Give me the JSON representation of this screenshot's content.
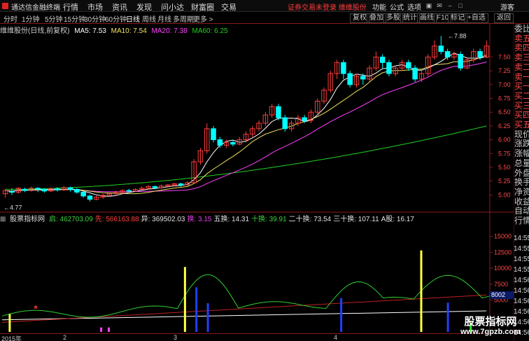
{
  "app": {
    "title": "通达信金融终端"
  },
  "menu": [
    "行情",
    "市场",
    "资讯",
    "发现",
    "问小达",
    "财富圈",
    "交易"
  ],
  "marquee": "证券交易未登录 维维股份",
  "right_menu": [
    "功能",
    "公式",
    "选项"
  ],
  "visitor": "游客",
  "toolbar": {
    "periods": [
      "分时",
      "1分钟",
      "5分钟",
      "15分钟",
      "30分钟",
      "60分钟",
      "日线",
      "周线",
      "月线",
      "多周期",
      "更多 >"
    ],
    "active_period": "日线",
    "buttons": [
      "复权",
      "叠加",
      "多股",
      "统计",
      "画线",
      "F10",
      "标记",
      "+自选",
      "返回"
    ]
  },
  "main_chart": {
    "title": "维维股份(日线,前复权)",
    "ma5": "MA5: 7.53",
    "ma10": "MA10: 7.54",
    "ma20": "MA20: 7.38",
    "ma60": "MA60: 6.25",
    "high_label": "7.88",
    "low_label": "4.77",
    "y_ticks": [
      "7.50",
      "7.25",
      "7.00",
      "6.75",
      "6.50",
      "6.25",
      "6.00",
      "5.75",
      "5.50",
      "5.25",
      "5.00"
    ]
  },
  "indicator": {
    "name": "股票指标网",
    "values": [
      {
        "label": "启: 462703.09",
        "color": "#40d040"
      },
      {
        "label": "先: 566163.88",
        "color": "#ff4040"
      },
      {
        "label": "异: 369502.03",
        "color": "#e0e0e0"
      },
      {
        "label": "换: 3.15",
        "color": "#e040e0"
      },
      {
        "label": "五换: 14.31",
        "color": "#e0e0e0"
      },
      {
        "label": "十换: 39.91",
        "color": "#40d040"
      },
      {
        "label": "二十换: 73.54",
        "color": "#e0e0e0"
      },
      {
        "label": "三十换: 107.11",
        "color": "#e0e0e0"
      },
      {
        "label": "A股: 16.17",
        "color": "#e0e0e0"
      }
    ],
    "y_ticks": [
      "15000",
      "12500",
      "10000",
      "7500",
      "5000"
    ],
    "box_value": "8002"
  },
  "x_axis": [
    "2015年",
    "2",
    "3",
    "4"
  ],
  "sidebar": [
    "委比",
    "卖五",
    "卖四",
    "卖三",
    "卖二",
    "卖一",
    "买一",
    "买二",
    "买三",
    "买四",
    "买五",
    "现价",
    "涨跌",
    "涨幅",
    "总量",
    "外盘",
    "换手",
    "净资",
    "收益",
    "自动",
    "行情"
  ],
  "times": [
    "14:55",
    "14:55",
    "14:55",
    "14:55",
    "14:56",
    "14:56",
    "14:56",
    "14:56",
    "14:56",
    "14:56"
  ],
  "watermark": {
    "title": "股票指标网",
    "url": "www.7gpzb.com"
  },
  "colors": {
    "up": "#ff3b3b",
    "down": "#00ffff",
    "ma5": "#ffffff",
    "ma10": "#f0e060",
    "ma20": "#ff40ff",
    "ma60": "#20d020"
  },
  "chart_data": [
    {
      "type": "candlestick",
      "title": "维维股份(日线,前复权)",
      "ylim": [
        4.75,
        7.95
      ],
      "series": [
        {
          "name": "MA5",
          "value": 7.53
        },
        {
          "name": "MA10",
          "value": 7.54
        },
        {
          "name": "MA20",
          "value": 7.38
        },
        {
          "name": "MA60",
          "value": 6.25
        }
      ],
      "candles": [
        [
          5.02,
          5.08,
          4.95,
          5.1
        ],
        [
          5.06,
          5.05,
          5.0,
          5.12
        ],
        [
          5.05,
          5.12,
          5.02,
          5.14
        ],
        [
          5.1,
          5.08,
          5.05,
          5.13
        ],
        [
          5.08,
          5.12,
          5.06,
          5.15
        ],
        [
          5.12,
          5.1,
          5.05,
          5.14
        ],
        [
          5.1,
          5.07,
          5.04,
          5.12
        ],
        [
          5.07,
          5.11,
          5.05,
          5.13
        ],
        [
          5.11,
          5.09,
          5.06,
          5.14
        ],
        [
          5.09,
          5.13,
          5.07,
          5.16
        ],
        [
          5.13,
          5.1,
          5.06,
          5.15
        ],
        [
          5.1,
          5.05,
          5.02,
          5.12
        ],
        [
          5.05,
          4.98,
          4.95,
          5.08
        ],
        [
          4.98,
          4.92,
          4.88,
          5.0
        ],
        [
          4.92,
          4.96,
          4.9,
          4.99
        ],
        [
          4.96,
          4.99,
          4.93,
          5.02
        ],
        [
          4.99,
          5.02,
          4.96,
          5.05
        ],
        [
          5.02,
          5.05,
          5.0,
          5.08
        ],
        [
          5.05,
          5.08,
          5.02,
          5.1
        ],
        [
          5.08,
          5.07,
          5.04,
          5.11
        ],
        [
          5.07,
          5.1,
          5.05,
          5.12
        ],
        [
          5.1,
          5.12,
          5.08,
          5.15
        ],
        [
          5.12,
          5.15,
          5.1,
          5.18
        ],
        [
          5.15,
          5.13,
          5.1,
          5.17
        ],
        [
          5.13,
          5.16,
          5.11,
          5.19
        ],
        [
          5.16,
          5.18,
          5.14,
          5.2
        ],
        [
          5.18,
          5.2,
          5.16,
          5.22
        ],
        [
          5.2,
          5.18,
          5.15,
          5.22
        ],
        [
          5.18,
          5.22,
          5.17,
          5.25
        ],
        [
          5.22,
          5.6,
          5.2,
          5.65
        ],
        [
          5.6,
          5.8,
          5.55,
          5.85
        ],
        [
          5.8,
          6.2,
          5.75,
          6.3
        ],
        [
          6.2,
          6.0,
          5.95,
          6.25
        ],
        [
          6.0,
          5.9,
          5.85,
          6.05
        ],
        [
          5.9,
          5.95,
          5.85,
          6.0
        ],
        [
          5.95,
          5.92,
          5.88,
          6.0
        ],
        [
          5.92,
          6.0,
          5.9,
          6.05
        ],
        [
          6.0,
          6.1,
          5.95,
          6.15
        ],
        [
          6.1,
          6.2,
          6.05,
          6.25
        ],
        [
          6.2,
          6.3,
          6.15,
          6.35
        ],
        [
          6.3,
          6.45,
          6.25,
          6.5
        ],
        [
          6.45,
          6.6,
          6.4,
          6.65
        ],
        [
          6.6,
          6.4,
          6.35,
          6.65
        ],
        [
          6.4,
          6.2,
          6.15,
          6.45
        ],
        [
          6.2,
          6.3,
          6.15,
          6.35
        ],
        [
          6.3,
          6.4,
          6.25,
          6.45
        ],
        [
          6.4,
          6.35,
          6.3,
          6.45
        ],
        [
          6.35,
          6.5,
          6.3,
          6.55
        ],
        [
          6.5,
          6.7,
          6.45,
          6.75
        ],
        [
          6.7,
          6.9,
          6.65,
          6.95
        ],
        [
          6.9,
          7.2,
          6.85,
          7.25
        ],
        [
          7.2,
          7.4,
          7.1,
          7.45
        ],
        [
          7.4,
          7.2,
          7.1,
          7.45
        ],
        [
          7.2,
          7.0,
          6.95,
          7.25
        ],
        [
          7.0,
          7.15,
          6.95,
          7.2
        ],
        [
          7.15,
          7.1,
          7.0,
          7.2
        ],
        [
          7.1,
          7.3,
          7.05,
          7.35
        ],
        [
          7.3,
          7.5,
          7.25,
          7.6
        ],
        [
          7.5,
          7.4,
          7.3,
          7.55
        ],
        [
          7.4,
          7.2,
          7.15,
          7.45
        ],
        [
          7.2,
          7.3,
          7.15,
          7.35
        ],
        [
          7.3,
          7.4,
          7.25,
          7.45
        ],
        [
          7.4,
          7.3,
          7.25,
          7.45
        ],
        [
          7.3,
          7.1,
          7.05,
          7.35
        ],
        [
          7.1,
          7.2,
          7.05,
          7.25
        ],
        [
          7.2,
          7.5,
          7.15,
          7.55
        ],
        [
          7.5,
          7.7,
          7.45,
          7.8
        ],
        [
          7.7,
          7.6,
          7.55,
          7.88
        ],
        [
          7.6,
          7.5,
          7.45,
          7.65
        ],
        [
          7.5,
          7.55,
          7.45,
          7.6
        ],
        [
          7.55,
          7.3,
          7.25,
          7.6
        ],
        [
          7.3,
          7.45,
          7.28,
          7.5
        ],
        [
          7.45,
          7.6,
          7.4,
          7.65
        ],
        [
          7.6,
          7.5,
          7.45,
          7.65
        ],
        [
          7.5,
          7.7,
          7.48,
          7.8
        ]
      ]
    },
    {
      "type": "bar",
      "title": "股票指标网",
      "ylim": [
        0,
        16500
      ],
      "bars": [
        {
          "index": 2,
          "value": 2800,
          "color": "yellow"
        },
        {
          "index": 26,
          "value": 700,
          "color": "magenta"
        },
        {
          "index": 28,
          "value": 700,
          "color": "magenta"
        },
        {
          "index": 48,
          "value": 10200,
          "color": "yellow"
        },
        {
          "index": 51,
          "value": 7000,
          "color": "blue"
        },
        {
          "index": 54,
          "value": 4500,
          "color": "blue"
        },
        {
          "index": 89,
          "value": 5300,
          "color": "blue"
        },
        {
          "index": 110,
          "value": 12800,
          "color": "yellow"
        },
        {
          "index": 117,
          "value": 4600,
          "color": "blue"
        },
        {
          "index": 123,
          "value": 1500,
          "color": "green"
        }
      ]
    }
  ]
}
